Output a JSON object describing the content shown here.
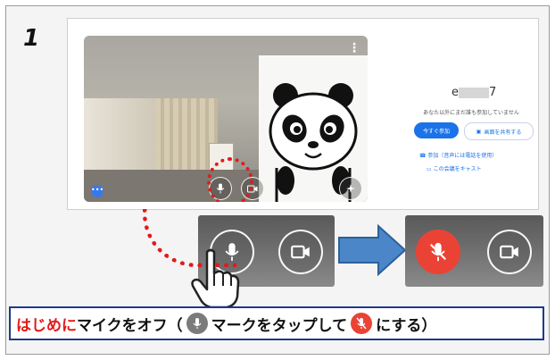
{
  "step": {
    "number": "1"
  },
  "meet": {
    "name_prefix": "e",
    "name_suffix": "7",
    "no_one_here": "あなた以外にまだ誰も参加していません",
    "join_now_label": "今すぐ参加",
    "present_label": "画面を共有する",
    "phone_audio_label": "参加（音声には電話を使用）",
    "cast_label": "この会議をキャスト",
    "dots": "⋮",
    "more_label": "•••"
  },
  "caption": {
    "part1_red": "はじめに",
    "part2": "マイクをオフ（",
    "part3": "マークをタップして",
    "part4": "にする）"
  },
  "colors": {
    "meet_blue": "#1a73e8",
    "mute_red": "#ea4335",
    "highlight_red": "#e21a1a",
    "arrow_blue": "#4a86c8",
    "caption_border": "#1b3a8a"
  }
}
